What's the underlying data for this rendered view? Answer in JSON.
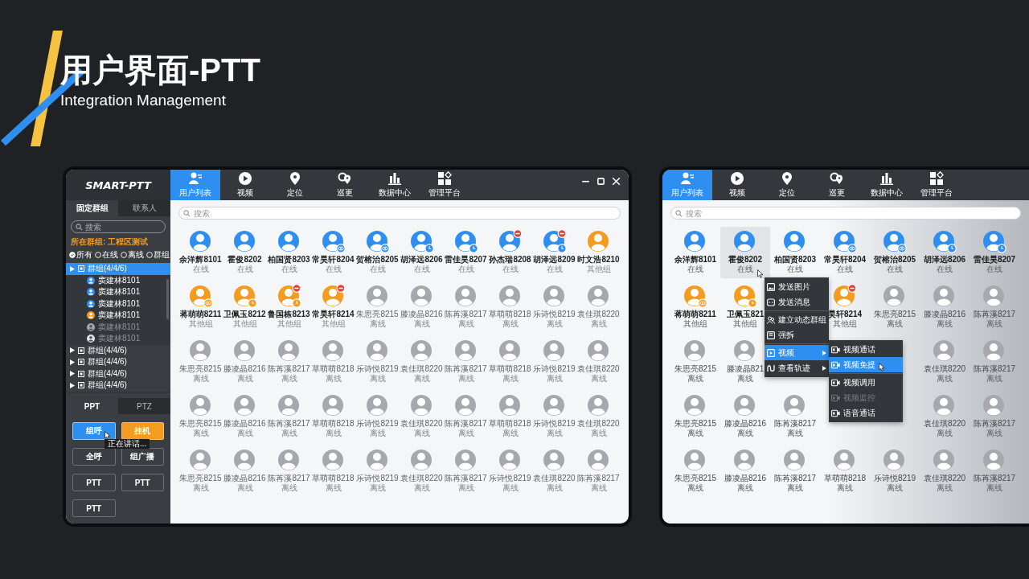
{
  "header": {
    "title": "用户界面-PTT",
    "subtitle": "Integration Management"
  },
  "main_window": {
    "sidebar": {
      "logo": "SMART-PTT",
      "tabs": [
        {
          "label": "固定群组",
          "selected": true
        },
        {
          "label": "联系人",
          "selected": false
        }
      ],
      "search": {
        "placeholder": "搜索"
      },
      "current_group": "所在群组: 工程区测试",
      "filters": [
        {
          "label": "所有",
          "selected": true
        },
        {
          "label": "在线",
          "selected": false
        },
        {
          "label": "离线",
          "selected": false
        },
        {
          "label": "群组",
          "selected": false
        }
      ],
      "tree": [
        {
          "label": "群组(4/4/6)",
          "selected": true,
          "children": [
            {
              "label": "窦建林8101",
              "color": "#2f8ff0",
              "online": true
            },
            {
              "label": "窦建林8101",
              "color": "#2f8ff0",
              "online": true
            },
            {
              "label": "窦建林8101",
              "color": "#2f8ff0",
              "online": true
            },
            {
              "label": "窦建林8101",
              "color": "#f39c1f",
              "online": true
            },
            {
              "label": "窦建林8101",
              "color": "#a6a8ad",
              "online": false
            },
            {
              "label": "窦建林8101",
              "color": "#e6e6e6",
              "online": false
            }
          ]
        },
        {
          "label": "群组(4/4/6)",
          "selected": false
        },
        {
          "label": "群组(4/4/6)",
          "selected": false
        },
        {
          "label": "群组(4/4/6)",
          "selected": false
        },
        {
          "label": "群组(4/4/6)",
          "selected": false
        }
      ],
      "ptt_tabs": [
        {
          "label": "PPT",
          "selected": true
        },
        {
          "label": "PTZ",
          "selected": false
        }
      ],
      "buttons": [
        {
          "label": "组呼",
          "kind": "primary",
          "tooltip": "正在讲话..."
        },
        {
          "label": "挂机",
          "kind": "warning"
        },
        {
          "label": "全呼",
          "kind": "default"
        },
        {
          "label": "组广播",
          "kind": "default"
        },
        {
          "label": "PTT",
          "kind": "default"
        },
        {
          "label": "PTT",
          "kind": "default"
        },
        {
          "label": "PTT",
          "kind": "default"
        }
      ]
    },
    "nav": [
      {
        "label": "用户列表",
        "selected": true
      },
      {
        "label": "视频",
        "selected": false
      },
      {
        "label": "定位",
        "selected": false
      },
      {
        "label": "巡更",
        "selected": false
      },
      {
        "label": "数据中心",
        "selected": false
      },
      {
        "label": "管理平台",
        "selected": false
      }
    ],
    "search": {
      "placeholder": "搜索"
    },
    "contacts": [
      [
        {
          "name": "余洋辉8101",
          "status": "在线",
          "color": "#2f8ff0",
          "active": true,
          "monitored": false,
          "scheduled": false,
          "busy": false
        },
        {
          "name": "霍俊8202",
          "status": "在线",
          "color": "#2f8ff0",
          "active": true,
          "monitored": false,
          "scheduled": false,
          "busy": false
        },
        {
          "name": "柏国贤8203",
          "status": "在线",
          "color": "#2f8ff0",
          "active": true,
          "monitored": false,
          "scheduled": false,
          "busy": false
        },
        {
          "name": "常昊轩8204",
          "status": "在线",
          "color": "#2f8ff0",
          "active": true,
          "monitored": true,
          "scheduled": false,
          "busy": false
        },
        {
          "name": "贺榕治8205",
          "status": "在线",
          "color": "#2f8ff0",
          "active": true,
          "monitored": true,
          "scheduled": false,
          "busy": false
        },
        {
          "name": "胡泽远8206",
          "status": "在线",
          "color": "#2f8ff0",
          "active": true,
          "monitored": false,
          "scheduled": true,
          "busy": false
        },
        {
          "name": "雷佳昊8207",
          "status": "在线",
          "color": "#2f8ff0",
          "active": true,
          "monitored": false,
          "scheduled": true,
          "busy": false
        },
        {
          "name": "孙杰瑞8208",
          "status": "在线",
          "color": "#2f8ff0",
          "active": true,
          "monitored": false,
          "scheduled": false,
          "busy": true
        },
        {
          "name": "胡泽远8209",
          "status": "在线",
          "color": "#2f8ff0",
          "active": true,
          "monitored": false,
          "scheduled": true,
          "busy": true
        },
        {
          "name": "时文浩8210",
          "status": "其他组",
          "color": "#f39c1f",
          "active": true,
          "monitored": false,
          "scheduled": false,
          "busy": false
        }
      ],
      [
        {
          "name": "蒋萌萌8211",
          "status": "其他组",
          "color": "#f39c1f",
          "active": true,
          "monitored": true,
          "scheduled": false,
          "busy": false
        },
        {
          "name": "卫佩玉8212",
          "status": "其他组",
          "color": "#f39c1f",
          "active": true,
          "monitored": false,
          "scheduled": true,
          "busy": false
        },
        {
          "name": "鲁国栋8213",
          "status": "其他组",
          "color": "#f39c1f",
          "active": true,
          "monitored": false,
          "scheduled": true,
          "busy": true
        },
        {
          "name": "常昊轩8214",
          "status": "其他组",
          "color": "#f39c1f",
          "active": true,
          "monitored": false,
          "scheduled": false,
          "busy": true
        },
        {
          "name": "朱思亮8215",
          "status": "离线",
          "color": "#a6a8ad",
          "active": false,
          "monitored": false,
          "scheduled": false,
          "busy": false
        },
        {
          "name": "滕凌晶8216",
          "status": "离线",
          "color": "#a6a8ad",
          "active": false,
          "monitored": false,
          "scheduled": false,
          "busy": false
        },
        {
          "name": "陈苒溪8217",
          "status": "离线",
          "color": "#a6a8ad",
          "active": false,
          "monitored": false,
          "scheduled": false,
          "busy": false
        },
        {
          "name": "草萌萌8218",
          "status": "离线",
          "color": "#a6a8ad",
          "active": false,
          "monitored": false,
          "scheduled": false,
          "busy": false
        },
        {
          "name": "乐诗悦8219",
          "status": "离线",
          "color": "#a6a8ad",
          "active": false,
          "monitored": false,
          "scheduled": false,
          "busy": false
        },
        {
          "name": "袁佳琪8220",
          "status": "离线",
          "color": "#a6a8ad",
          "active": false,
          "monitored": false,
          "scheduled": false,
          "busy": false
        }
      ],
      [
        {
          "name": "朱思亮8215",
          "status": "离线",
          "color": "#a6a8ad",
          "active": false,
          "monitored": false,
          "scheduled": false,
          "busy": false
        },
        {
          "name": "滕凌晶8216",
          "status": "离线",
          "color": "#a6a8ad",
          "active": false,
          "monitored": false,
          "scheduled": false,
          "busy": false
        },
        {
          "name": "陈苒溪8217",
          "status": "离线",
          "color": "#a6a8ad",
          "active": false,
          "monitored": false,
          "scheduled": false,
          "busy": false
        },
        {
          "name": "草萌萌8218",
          "status": "离线",
          "color": "#a6a8ad",
          "active": false,
          "monitored": false,
          "scheduled": false,
          "busy": false
        },
        {
          "name": "乐诗悦8219",
          "status": "离线",
          "color": "#a6a8ad",
          "active": false,
          "monitored": false,
          "scheduled": false,
          "busy": false
        },
        {
          "name": "袁佳琪8220",
          "status": "离线",
          "color": "#a6a8ad",
          "active": false,
          "monitored": false,
          "scheduled": false,
          "busy": false
        },
        {
          "name": "陈苒溪8217",
          "status": "离线",
          "color": "#a6a8ad",
          "active": false,
          "monitored": false,
          "scheduled": false,
          "busy": false
        },
        {
          "name": "草萌萌8218",
          "status": "离线",
          "color": "#a6a8ad",
          "active": false,
          "monitored": false,
          "scheduled": false,
          "busy": false
        },
        {
          "name": "乐诗悦8219",
          "status": "离线",
          "color": "#a6a8ad",
          "active": false,
          "monitored": false,
          "scheduled": false,
          "busy": false
        },
        {
          "name": "袁佳琪8220",
          "status": "离线",
          "color": "#a6a8ad",
          "active": false,
          "monitored": false,
          "scheduled": false,
          "busy": false
        }
      ],
      [
        {
          "name": "朱思亮8215",
          "status": "离线",
          "color": "#a6a8ad",
          "active": false,
          "monitored": false,
          "scheduled": false,
          "busy": false
        },
        {
          "name": "滕凌晶8216",
          "status": "离线",
          "color": "#a6a8ad",
          "active": false,
          "monitored": false,
          "scheduled": false,
          "busy": false
        },
        {
          "name": "陈苒溪8217",
          "status": "离线",
          "color": "#a6a8ad",
          "active": false,
          "monitored": false,
          "scheduled": false,
          "busy": false
        },
        {
          "name": "草萌萌8218",
          "status": "离线",
          "color": "#a6a8ad",
          "active": false,
          "monitored": false,
          "scheduled": false,
          "busy": false
        },
        {
          "name": "乐诗悦8219",
          "status": "离线",
          "color": "#a6a8ad",
          "active": false,
          "monitored": false,
          "scheduled": false,
          "busy": false
        },
        {
          "name": "袁佳琪8220",
          "status": "离线",
          "color": "#a6a8ad",
          "active": false,
          "monitored": false,
          "scheduled": false,
          "busy": false
        },
        {
          "name": "陈苒溪8217",
          "status": "离线",
          "color": "#a6a8ad",
          "active": false,
          "monitored": false,
          "scheduled": false,
          "busy": false
        },
        {
          "name": "草萌萌8218",
          "status": "离线",
          "color": "#a6a8ad",
          "active": false,
          "monitored": false,
          "scheduled": false,
          "busy": false
        },
        {
          "name": "乐诗悦8219",
          "status": "离线",
          "color": "#a6a8ad",
          "active": false,
          "monitored": false,
          "scheduled": false,
          "busy": false
        },
        {
          "name": "袁佳琪8220",
          "status": "离线",
          "color": "#a6a8ad",
          "active": false,
          "monitored": false,
          "scheduled": false,
          "busy": false
        }
      ],
      [
        {
          "name": "朱思亮8215",
          "status": "离线",
          "color": "#a6a8ad",
          "active": false,
          "monitored": false,
          "scheduled": false,
          "busy": false
        },
        {
          "name": "滕凌晶8216",
          "status": "离线",
          "color": "#a6a8ad",
          "active": false,
          "monitored": false,
          "scheduled": false,
          "busy": false
        },
        {
          "name": "陈苒溪8217",
          "status": "离线",
          "color": "#a6a8ad",
          "active": false,
          "monitored": false,
          "scheduled": false,
          "busy": false
        },
        {
          "name": "草萌萌8218",
          "status": "离线",
          "color": "#a6a8ad",
          "active": false,
          "monitored": false,
          "scheduled": false,
          "busy": false
        },
        {
          "name": "乐诗悦8219",
          "status": "离线",
          "color": "#a6a8ad",
          "active": false,
          "monitored": false,
          "scheduled": false,
          "busy": false
        },
        {
          "name": "袁佳琪8220",
          "status": "离线",
          "color": "#a6a8ad",
          "active": false,
          "monitored": false,
          "scheduled": false,
          "busy": false
        },
        {
          "name": "陈苒溪8217",
          "status": "离线",
          "color": "#a6a8ad",
          "active": false,
          "monitored": false,
          "scheduled": false,
          "busy": false
        },
        {
          "name": "乐诗悦8219",
          "status": "离线",
          "color": "#a6a8ad",
          "active": false,
          "monitored": false,
          "scheduled": false,
          "busy": false
        },
        {
          "name": "袁佳琪8220",
          "status": "离线",
          "color": "#a6a8ad",
          "active": false,
          "monitored": false,
          "scheduled": false,
          "busy": false
        },
        {
          "name": "陈苒溪8217",
          "status": "离线",
          "color": "#a6a8ad",
          "active": false,
          "monitored": false,
          "scheduled": false,
          "busy": false
        }
      ]
    ]
  },
  "preview_window": {
    "nav": [
      {
        "label": "用户列表",
        "selected": true
      },
      {
        "label": "视频",
        "selected": false
      },
      {
        "label": "定位",
        "selected": false
      },
      {
        "label": "巡更",
        "selected": false
      },
      {
        "label": "数据中心",
        "selected": false
      },
      {
        "label": "管理平台",
        "selected": false
      }
    ],
    "search": {
      "placeholder": "搜索"
    },
    "contacts": [
      [
        {
          "kind": "contact",
          "name": "余洋辉8101",
          "status": "在线",
          "color": "#2f8ff0",
          "active": true,
          "monitored": false,
          "scheduled": false,
          "busy": false,
          "highlighted": false
        },
        {
          "kind": "contact",
          "name": "霍俊8202",
          "status": "在线",
          "color": "#2f8ff0",
          "active": true,
          "monitored": false,
          "scheduled": false,
          "busy": false,
          "highlighted": true
        },
        {
          "kind": "contact",
          "name": "柏国贤8203",
          "status": "在线",
          "color": "#2f8ff0",
          "active": true,
          "monitored": false,
          "scheduled": false,
          "busy": false,
          "highlighted": false
        },
        {
          "kind": "contact",
          "name": "常昊轩8204",
          "status": "在线",
          "color": "#2f8ff0",
          "active": true,
          "monitored": true,
          "scheduled": false,
          "busy": false,
          "highlighted": false
        },
        {
          "kind": "contact",
          "name": "贺榕治8205",
          "status": "在线",
          "color": "#2f8ff0",
          "active": true,
          "monitored": true,
          "scheduled": false,
          "busy": false,
          "highlighted": false
        },
        {
          "kind": "contact",
          "name": "胡泽远8206",
          "status": "在线",
          "color": "#2f8ff0",
          "active": true,
          "monitored": false,
          "scheduled": true,
          "busy": false,
          "highlighted": false
        },
        {
          "kind": "contact",
          "name": "雷佳昊8207",
          "status": "在线",
          "color": "#2f8ff0",
          "active": true,
          "monitored": false,
          "scheduled": true,
          "busy": false,
          "highlighted": false
        }
      ],
      [
        {
          "kind": "contact",
          "name": "蒋萌萌8211",
          "status": "其他组",
          "color": "#f39c1f",
          "active": true,
          "monitored": true,
          "scheduled": false,
          "busy": false,
          "highlighted": false
        },
        {
          "kind": "contact",
          "name": "卫佩玉821",
          "status": "其他组",
          "color": "#f39c1f",
          "active": true,
          "monitored": false,
          "scheduled": true,
          "busy": false,
          "highlighted": false
        },
        {
          "kind": "covered"
        },
        {
          "kind": "contact",
          "name": "昊轩8214",
          "status": "其他组",
          "color": "#f39c1f",
          "active": true,
          "monitored": false,
          "scheduled": false,
          "busy": true,
          "highlighted": false
        },
        {
          "kind": "contact",
          "name": "朱思亮8215",
          "status": "离线",
          "color": "#a6a8ad",
          "active": false,
          "monitored": false,
          "scheduled": false,
          "busy": false,
          "highlighted": false
        },
        {
          "kind": "contact",
          "name": "滕凌晶8216",
          "status": "离线",
          "color": "#a6a8ad",
          "active": false,
          "monitored": false,
          "scheduled": false,
          "busy": false,
          "highlighted": false
        },
        {
          "kind": "contact",
          "name": "陈苒溪8217",
          "status": "离线",
          "color": "#a6a8ad",
          "active": false,
          "monitored": false,
          "scheduled": false,
          "busy": false,
          "highlighted": false
        }
      ],
      [
        {
          "kind": "contact",
          "name": "朱思亮8215",
          "status": "离线",
          "color": "#a6a8ad",
          "active": false,
          "monitored": false,
          "scheduled": false,
          "busy": false,
          "highlighted": false
        },
        {
          "kind": "contact",
          "name": "滕凌晶821",
          "status": "离线",
          "color": "#a6a8ad",
          "active": false,
          "monitored": false,
          "scheduled": false,
          "busy": false,
          "highlighted": false
        },
        {
          "kind": "covered"
        },
        {
          "kind": "covered"
        },
        {
          "kind": "covered"
        },
        {
          "kind": "contact",
          "name": "袁佳琪8220",
          "status": "离线",
          "color": "#a6a8ad",
          "active": false,
          "monitored": false,
          "scheduled": false,
          "busy": false,
          "highlighted": false
        },
        {
          "kind": "contact",
          "name": "陈苒溪8217",
          "status": "离线",
          "color": "#a6a8ad",
          "active": false,
          "monitored": false,
          "scheduled": false,
          "busy": false,
          "highlighted": false
        }
      ],
      [
        {
          "kind": "contact",
          "name": "朱思亮8215",
          "status": "离线",
          "color": "#a6a8ad",
          "active": false,
          "monitored": false,
          "scheduled": false,
          "busy": false,
          "highlighted": false
        },
        {
          "kind": "contact",
          "name": "滕凌晶8216",
          "status": "离线",
          "color": "#a6a8ad",
          "active": false,
          "monitored": false,
          "scheduled": false,
          "busy": false,
          "highlighted": false
        },
        {
          "kind": "contact",
          "name": "陈苒溪8217",
          "status": "离线",
          "color": "#a6a8ad",
          "active": false,
          "monitored": false,
          "scheduled": false,
          "busy": false,
          "highlighted": false
        },
        {
          "kind": "covered"
        },
        {
          "kind": "covered"
        },
        {
          "kind": "contact",
          "name": "袁佳琪8220",
          "status": "离线",
          "color": "#a6a8ad",
          "active": false,
          "monitored": false,
          "scheduled": false,
          "busy": false,
          "highlighted": false
        },
        {
          "kind": "contact",
          "name": "陈苒溪8217",
          "status": "离线",
          "color": "#a6a8ad",
          "active": false,
          "monitored": false,
          "scheduled": false,
          "busy": false,
          "highlighted": false
        }
      ],
      [
        {
          "kind": "contact",
          "name": "朱思亮8215",
          "status": "离线",
          "color": "#a6a8ad",
          "active": false,
          "monitored": false,
          "scheduled": false,
          "busy": false,
          "highlighted": false
        },
        {
          "kind": "contact",
          "name": "滕凌晶8216",
          "status": "离线",
          "color": "#a6a8ad",
          "active": false,
          "monitored": false,
          "scheduled": false,
          "busy": false,
          "highlighted": false
        },
        {
          "kind": "contact",
          "name": "陈苒溪8217",
          "status": "离线",
          "color": "#a6a8ad",
          "active": false,
          "monitored": false,
          "scheduled": false,
          "busy": false,
          "highlighted": false
        },
        {
          "kind": "contact",
          "name": "草萌萌8218",
          "status": "离线",
          "color": "#a6a8ad",
          "active": false,
          "monitored": false,
          "scheduled": false,
          "busy": false,
          "highlighted": false
        },
        {
          "kind": "contact",
          "name": "乐诗悦8219",
          "status": "离线",
          "color": "#a6a8ad",
          "active": false,
          "monitored": false,
          "scheduled": false,
          "busy": false,
          "highlighted": false
        },
        {
          "kind": "contact",
          "name": "袁佳琪8220",
          "status": "离线",
          "color": "#a6a8ad",
          "active": false,
          "monitored": false,
          "scheduled": false,
          "busy": false,
          "highlighted": false
        },
        {
          "kind": "contact",
          "name": "陈苒溪8217",
          "status": "离线",
          "color": "#a6a8ad",
          "active": false,
          "monitored": false,
          "scheduled": false,
          "busy": false,
          "highlighted": false
        }
      ]
    ],
    "context_menu": {
      "groups": [
        [
          {
            "label": "发送图片",
            "selected": false,
            "submenu": false
          },
          {
            "label": "发送消息",
            "selected": false,
            "submenu": false
          }
        ],
        [
          {
            "label": "建立动态群组",
            "selected": false,
            "submenu": false
          },
          {
            "label": "强拆",
            "selected": false,
            "submenu": false
          }
        ],
        [
          {
            "label": "视频",
            "selected": true,
            "submenu": true
          },
          {
            "label": "查看轨迹",
            "selected": false,
            "submenu": true
          }
        ]
      ]
    },
    "submenu": {
      "groups": [
        [
          {
            "label": "视频通话",
            "selected": false,
            "disabled": false
          },
          {
            "label": "视频免提",
            "selected": true,
            "disabled": false
          }
        ],
        [
          {
            "label": "视频调用",
            "selected": false,
            "disabled": false
          },
          {
            "label": "视频监控",
            "selected": false,
            "disabled": true
          },
          {
            "label": "语音通话",
            "selected": false,
            "disabled": false
          }
        ]
      ]
    }
  }
}
